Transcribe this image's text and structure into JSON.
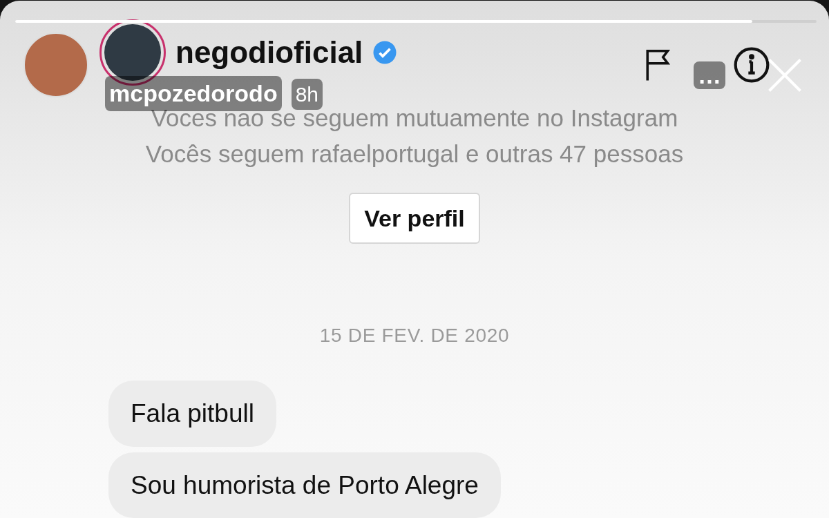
{
  "story": {
    "username": "mcpozedorodo",
    "time": "8h",
    "more": "…",
    "progress": {
      "level": 0.92
    }
  },
  "chat_header": {
    "username": "negodioficial",
    "verified": true
  },
  "info_lines": [
    "Voces nao se seguem mutuamente no Instagram",
    "Vocês seguem rafaelportugal e outras 47 pessoas"
  ],
  "profile_button": "Ver perfil",
  "date": "15 DE FEV. DE 2020",
  "messages": [
    {
      "text": "Fala pitbull"
    },
    {
      "text": "Sou humorista de Porto Alegre"
    }
  ]
}
